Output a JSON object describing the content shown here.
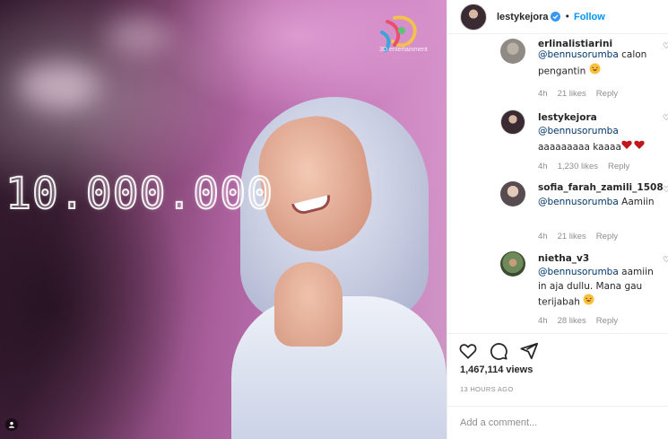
{
  "media": {
    "big_number": "10.000.000",
    "brand_text": "3D entertainment"
  },
  "header": {
    "username": "lestykejora",
    "separator": "•",
    "follow_label": "Follow"
  },
  "comments": [
    {
      "username": "erlinalistiarini",
      "mention": "@bennusorumba",
      "text": " calon pengantin",
      "emoji": "laughing-face",
      "time": "4h",
      "likes": "21 likes",
      "reply": "Reply"
    },
    {
      "username": "lestykejora",
      "mention": "@bennusorumba",
      "text": " aaaaaaaaa kaaaa",
      "emoji": "red-hearts",
      "time": "4h",
      "likes": "1,230 likes",
      "reply": "Reply"
    },
    {
      "username": "sofia_farah_zamili_1508",
      "mention": "@bennusorumba",
      "text": " Aamiin",
      "time": "4h",
      "likes": "21 likes",
      "reply": "Reply"
    },
    {
      "username": "nietha_v3",
      "mention": "@bennusorumba",
      "text": " aamiin in aja dullu. Mana gau terijabah",
      "emoji": "laughing-face",
      "time": "4h",
      "likes": "28 likes",
      "reply": "Reply"
    }
  ],
  "stats": {
    "views": "1,467,114 views",
    "timestamp": "13 HOURS AGO"
  },
  "add_comment": {
    "placeholder": "Add a comment..."
  },
  "colors": {
    "link_blue": "#0095f6",
    "mention_blue": "#00376b",
    "muted_grey": "#8e8e8e"
  }
}
